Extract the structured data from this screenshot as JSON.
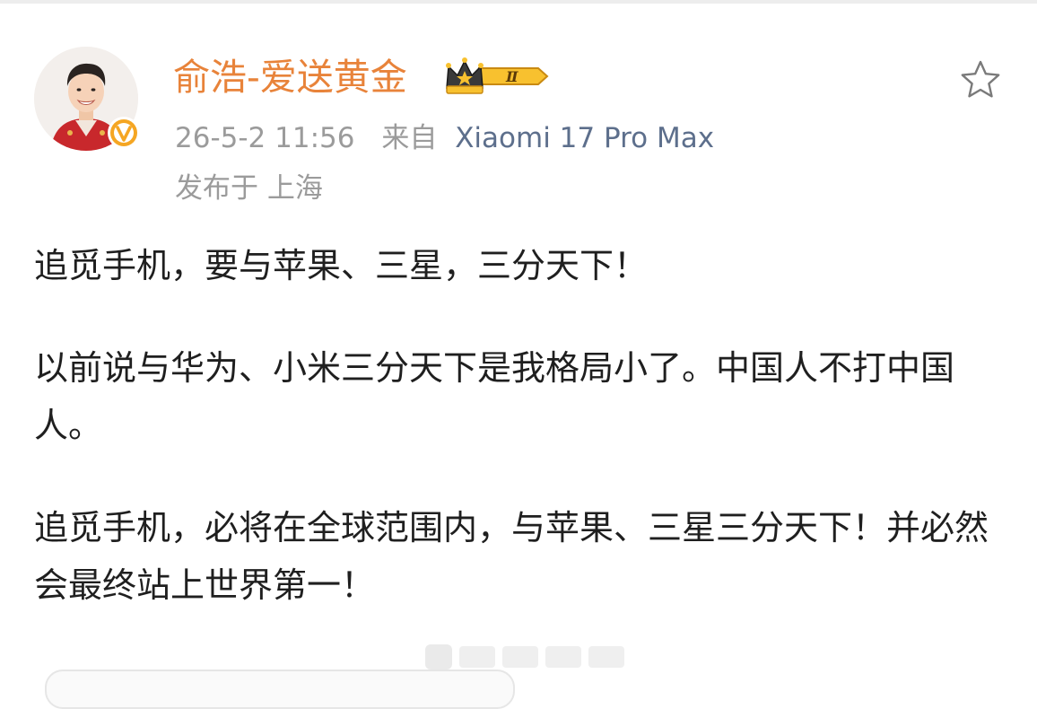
{
  "post": {
    "username": "俞浩-爱送黄金",
    "vip_level": "Ⅱ",
    "timestamp": "26-5-2 11:56",
    "from_label": "来自",
    "device": "Xiaomi 17 Pro Max",
    "location": "发布于 上海",
    "paragraphs": [
      "追觅手机，要与苹果、三星，三分天下！",
      "以前说与华为、小米三分天下是我格局小了。中国人不打中国人。",
      "追觅手机，必将在全球范围内，与苹果、三星三分天下！并必然会最终站上世界第一！"
    ]
  },
  "icons": {
    "favorite": "star-outline-icon",
    "verified": "verified-v-icon",
    "vip": "crown-vip-icon"
  },
  "colors": {
    "username": "#e8833a",
    "device": "#5d6f8c",
    "meta": "#9b9b9b",
    "body_text": "#1f1f1f",
    "verified_badge": "#f5a623"
  }
}
